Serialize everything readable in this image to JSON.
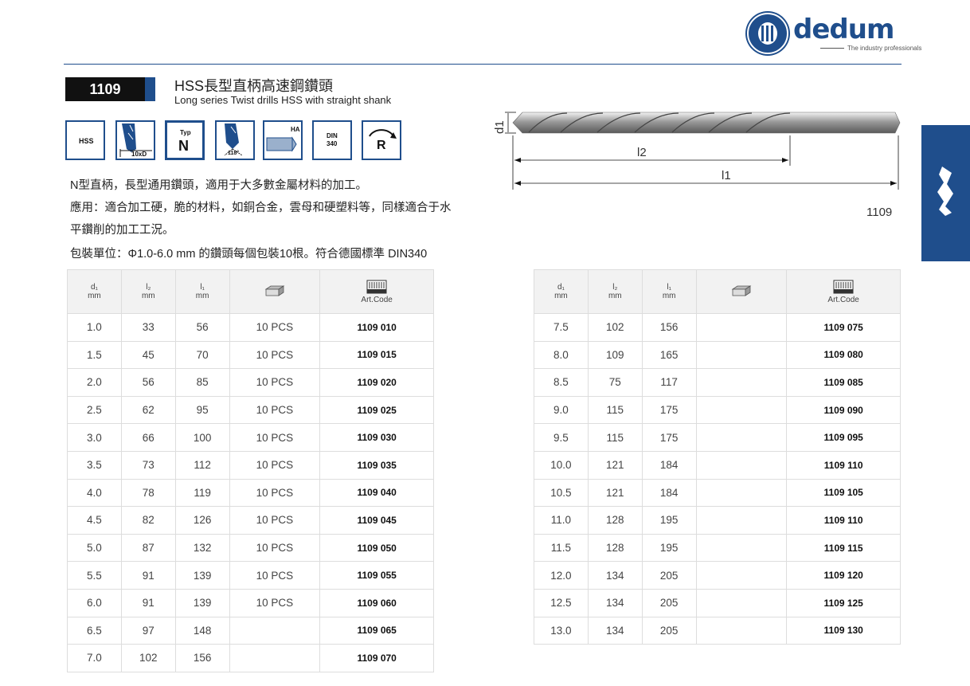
{
  "brand": {
    "name": "dedum",
    "tagline": "The industry professionals"
  },
  "product": {
    "code": "1109",
    "title_zh": "HSS長型直柄高速鋼鑽頭",
    "title_en": "Long series Twist drills HSS with straight shank"
  },
  "icons": {
    "hss": "HSS",
    "length": "10xD",
    "typ_label": "Typ",
    "typ_value": "N",
    "angle": "118°",
    "shank": "HA",
    "din_line1": "DIN",
    "din_line2": "340",
    "rotation": "R"
  },
  "description": [
    "N型直柄，長型通用鑽頭，適用于大多數金屬材料的加工。",
    "應用：適合加工硬，脆的材料，如銅合金，雲母和硬塑料等，同樣適合于水",
    "平鑽削的加工工況。",
    "包裝單位：Φ1.0-6.0 mm 的鑽頭每個包裝10根。符合德國標準 DIN340"
  ],
  "diagram": {
    "d1": "d1",
    "l2": "l2",
    "l1": "l1",
    "code": "1109"
  },
  "table_headers": {
    "d1": "d₁",
    "l2": "l₂",
    "l1": "l₁",
    "unit": "mm",
    "art_code": "Art.Code",
    "pack_icon": "package-icon",
    "code_icon": "barcode-icon"
  },
  "table_left": [
    {
      "d1": "1.0",
      "l2": "33",
      "l1": "56",
      "pack": "10 PCS",
      "code": "1109 010"
    },
    {
      "d1": "1.5",
      "l2": "45",
      "l1": "70",
      "pack": "10 PCS",
      "code": "1109 015"
    },
    {
      "d1": "2.0",
      "l2": "56",
      "l1": "85",
      "pack": "10 PCS",
      "code": "1109 020"
    },
    {
      "d1": "2.5",
      "l2": "62",
      "l1": "95",
      "pack": "10 PCS",
      "code": "1109 025"
    },
    {
      "d1": "3.0",
      "l2": "66",
      "l1": "100",
      "pack": "10 PCS",
      "code": "1109 030"
    },
    {
      "d1": "3.5",
      "l2": "73",
      "l1": "112",
      "pack": "10 PCS",
      "code": "1109 035"
    },
    {
      "d1": "4.0",
      "l2": "78",
      "l1": "119",
      "pack": "10 PCS",
      "code": "1109 040"
    },
    {
      "d1": "4.5",
      "l2": "82",
      "l1": "126",
      "pack": "10 PCS",
      "code": "1109 045"
    },
    {
      "d1": "5.0",
      "l2": "87",
      "l1": "132",
      "pack": "10 PCS",
      "code": "1109 050"
    },
    {
      "d1": "5.5",
      "l2": "91",
      "l1": "139",
      "pack": "10 PCS",
      "code": "1109 055"
    },
    {
      "d1": "6.0",
      "l2": "91",
      "l1": "139",
      "pack": "10 PCS",
      "code": "1109 060"
    },
    {
      "d1": "6.5",
      "l2": "97",
      "l1": "148",
      "pack": "",
      "code": "1109 065"
    },
    {
      "d1": "7.0",
      "l2": "102",
      "l1": "156",
      "pack": "",
      "code": "1109 070"
    }
  ],
  "table_right": [
    {
      "d1": "7.5",
      "l2": "102",
      "l1": "156",
      "pack": "",
      "code": "1109 075"
    },
    {
      "d1": "8.0",
      "l2": "109",
      "l1": "165",
      "pack": "",
      "code": "1109 080"
    },
    {
      "d1": "8.5",
      "l2": "75",
      "l1": "117",
      "pack": "",
      "code": "1109 085"
    },
    {
      "d1": "9.0",
      "l2": "115",
      "l1": "175",
      "pack": "",
      "code": "1109 090"
    },
    {
      "d1": "9.5",
      "l2": "115",
      "l1": "175",
      "pack": "",
      "code": "1109 095"
    },
    {
      "d1": "10.0",
      "l2": "121",
      "l1": "184",
      "pack": "",
      "code": "1109 110"
    },
    {
      "d1": "10.5",
      "l2": "121",
      "l1": "184",
      "pack": "",
      "code": "1109 105"
    },
    {
      "d1": "11.0",
      "l2": "128",
      "l1": "195",
      "pack": "",
      "code": "1109 110"
    },
    {
      "d1": "11.5",
      "l2": "128",
      "l1": "195",
      "pack": "",
      "code": "1109 115"
    },
    {
      "d1": "12.0",
      "l2": "134",
      "l1": "205",
      "pack": "",
      "code": "1109 120"
    },
    {
      "d1": "12.5",
      "l2": "134",
      "l1": "205",
      "pack": "",
      "code": "1109 125"
    },
    {
      "d1": "13.0",
      "l2": "134",
      "l1": "205",
      "pack": "",
      "code": "1109 130"
    }
  ],
  "colors": {
    "brand_blue": "#1f4e8c",
    "badge_black": "#111111"
  }
}
